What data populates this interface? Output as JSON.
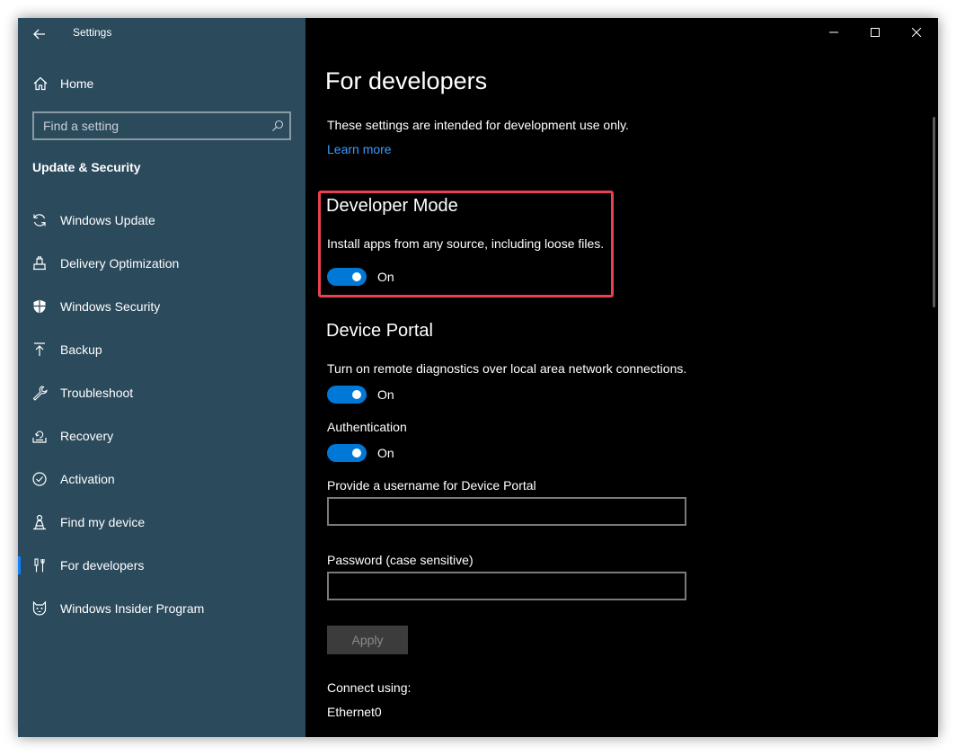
{
  "window": {
    "title": "Settings"
  },
  "sidebar": {
    "home_label": "Home",
    "search_placeholder": "Find a setting",
    "section_title": "Update & Security",
    "items": [
      {
        "label": "Windows Update",
        "icon": "refresh-icon"
      },
      {
        "label": "Delivery Optimization",
        "icon": "delivery-optimization-icon"
      },
      {
        "label": "Windows Security",
        "icon": "shield-icon"
      },
      {
        "label": "Backup",
        "icon": "upload-arrow-icon"
      },
      {
        "label": "Troubleshoot",
        "icon": "wrench-icon"
      },
      {
        "label": "Recovery",
        "icon": "recovery-icon"
      },
      {
        "label": "Activation",
        "icon": "check-circle-icon"
      },
      {
        "label": "Find my device",
        "icon": "person-location-icon"
      },
      {
        "label": "For developers",
        "icon": "developer-tools-icon",
        "selected": true
      },
      {
        "label": "Windows Insider Program",
        "icon": "insider-cat-icon"
      }
    ]
  },
  "main": {
    "page_title": "For developers",
    "intro_text": "These settings are intended for development use only.",
    "learn_more": "Learn more",
    "developer_mode": {
      "heading": "Developer Mode",
      "description": "Install apps from any source, including loose files.",
      "toggle_state": "On"
    },
    "device_portal": {
      "heading": "Device Portal",
      "description": "Turn on remote diagnostics over local area network connections.",
      "toggle_state": "On",
      "auth_label": "Authentication",
      "auth_toggle_state": "On",
      "username_label": "Provide a username for Device Portal",
      "username_value": "",
      "password_label": "Password (case sensitive)",
      "password_value": "",
      "apply_label": "Apply",
      "connect_label": "Connect using:",
      "connect_value": "Ethernet0"
    }
  },
  "colors": {
    "sidebar_bg": "#2b4a5c",
    "main_bg": "#000000",
    "accent": "#0078d7",
    "link": "#3b9bff",
    "highlight_border": "#e8414f",
    "selected_indicator": "#0a84ff"
  }
}
